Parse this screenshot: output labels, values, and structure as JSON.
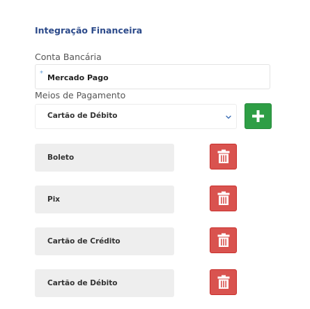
{
  "section": {
    "title": "Integração Financeira"
  },
  "conta": {
    "label": "Conta Bancária",
    "required_marker": "*",
    "value": "Mercado Pago"
  },
  "meios": {
    "label": "Meios de Pagamento",
    "selected": "Cartão de Débito",
    "items": [
      {
        "label": "Boleto"
      },
      {
        "label": "Pix"
      },
      {
        "label": "Cartão de Crédito"
      },
      {
        "label": "Cartão de Débito"
      }
    ]
  },
  "icons": {
    "dropdown": "chevron-down-icon",
    "add": "plus-icon",
    "delete": "trash-icon"
  },
  "colors": {
    "title": "#2c4a8a",
    "add_button": "#2e9e45",
    "delete_button": "#d9534f",
    "row_background": "#eeeeee",
    "required_marker": "#6aa2d8"
  }
}
